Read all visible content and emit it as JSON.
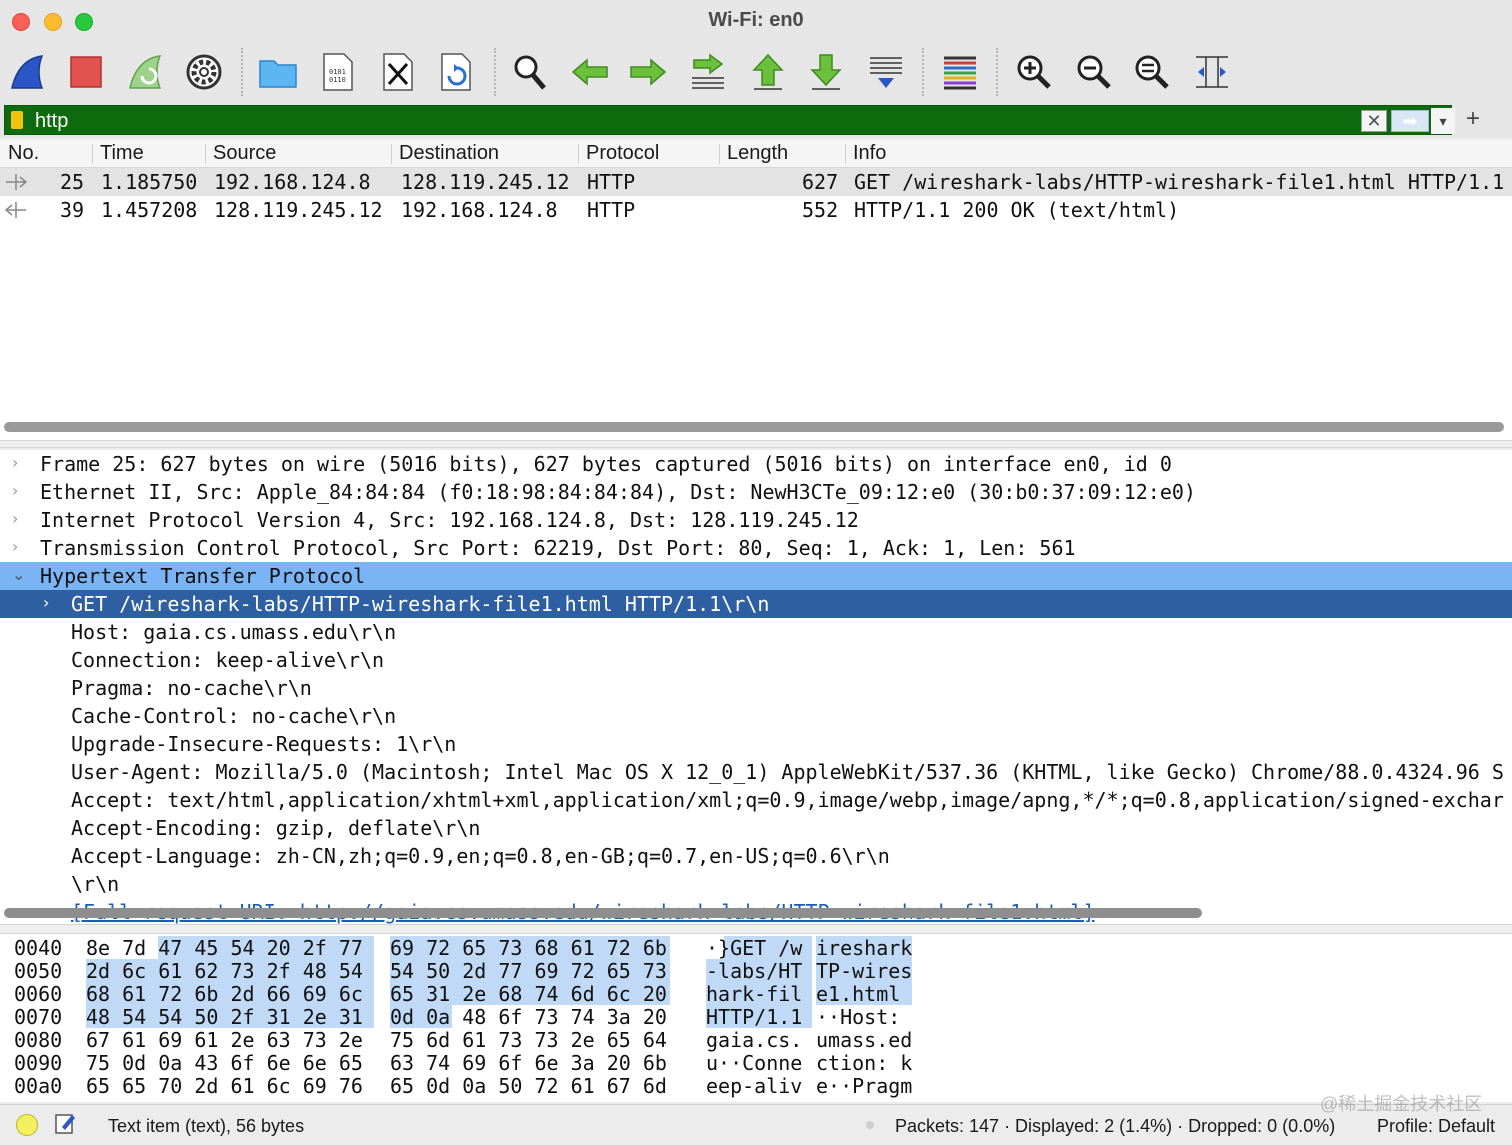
{
  "window": {
    "title": "Wi-Fi: en0"
  },
  "toolbar": {
    "buttons": [
      "shark-fin-start-icon",
      "stop-square-icon",
      "restart-fin-icon",
      "capture-options-gear-icon",
      "open-folder-icon",
      "save-file-icon",
      "close-file-icon",
      "reload-file-icon",
      "find-magnifier-icon",
      "go-back-arrow-icon",
      "go-forward-arrow-icon",
      "go-to-packet-icon",
      "first-packet-icon",
      "last-packet-icon",
      "autoscroll-icon",
      "colorize-icon",
      "zoom-in-icon",
      "zoom-out-icon",
      "normal-size-icon",
      "resize-columns-icon"
    ]
  },
  "filter": {
    "value": "http",
    "clear_glyph": "✕",
    "apply_glyph": "➡",
    "dropdown_glyph": "▾",
    "add_glyph": "+"
  },
  "packet_list": {
    "columns": [
      "No.",
      "Time",
      "Source",
      "Destination",
      "Protocol",
      "Length",
      "Info"
    ],
    "rows": [
      {
        "no": "25",
        "time": "1.185750",
        "source": "192.168.124.8",
        "destination": "128.119.245.12",
        "protocol": "HTTP",
        "length": "627",
        "info": "GET /wireshark-labs/HTTP-wireshark-file1.html HTTP/1.1"
      },
      {
        "no": "39",
        "time": "1.457208",
        "source": "128.119.245.12",
        "destination": "192.168.124.8",
        "protocol": "HTTP",
        "length": "552",
        "info": "HTTP/1.1 200 OK  (text/html)"
      }
    ]
  },
  "details": {
    "tree": [
      {
        "arrow": "›",
        "text": "Frame 25: 627 bytes on wire (5016 bits), 627 bytes captured (5016 bits) on interface en0, id 0"
      },
      {
        "arrow": "›",
        "text": "Ethernet II, Src: Apple_84:84:84 (f0:18:98:84:84:84), Dst: NewH3CTe_09:12:e0 (30:b0:37:09:12:e0)"
      },
      {
        "arrow": "›",
        "text": "Internet Protocol Version 4, Src: 192.168.124.8, Dst: 128.119.245.12"
      },
      {
        "arrow": "›",
        "text": "Transmission Control Protocol, Src Port: 62219, Dst Port: 80, Seq: 1, Ack: 1, Len: 561"
      },
      {
        "arrow": "⌄",
        "text": "Hypertext Transfer Protocol"
      },
      {
        "arrow": "›",
        "text": "GET /wireshark-labs/HTTP-wireshark-file1.html HTTP/1.1\\r\\n"
      },
      {
        "text": "Host: gaia.cs.umass.edu\\r\\n"
      },
      {
        "text": "Connection: keep-alive\\r\\n"
      },
      {
        "text": "Pragma: no-cache\\r\\n"
      },
      {
        "text": "Cache-Control: no-cache\\r\\n"
      },
      {
        "text": "Upgrade-Insecure-Requests: 1\\r\\n"
      },
      {
        "text": "User-Agent: Mozilla/5.0 (Macintosh; Intel Mac OS X 12_0_1) AppleWebKit/537.36 (KHTML, like Gecko) Chrome/88.0.4324.96 S"
      },
      {
        "text": "Accept: text/html,application/xhtml+xml,application/xml;q=0.9,image/webp,image/apng,*/*;q=0.8,application/signed-exchar"
      },
      {
        "text": "Accept-Encoding: gzip, deflate\\r\\n"
      },
      {
        "text": "Accept-Language: zh-CN,zh;q=0.9,en;q=0.8,en-GB;q=0.7,en-US;q=0.6\\r\\n"
      },
      {
        "text": "\\r\\n"
      },
      {
        "text": "[Full request URI: http://gaia.cs.umass.edu/wireshark-labs/HTTP-wireshark-file1.html]"
      }
    ]
  },
  "bytes": {
    "rows": [
      {
        "offset": "0040",
        "hex_left": "8e 7d 47 45 54 20 2f 77",
        "hex_right": "69 72 65 73 68 61 72 6b",
        "ascii_left": "·}GET /w",
        "ascii_right": "ireshark"
      },
      {
        "offset": "0050",
        "hex_left": "2d 6c 61 62 73 2f 48 54",
        "hex_right": "54 50 2d 77 69 72 65 73",
        "ascii_left": "-labs/HT",
        "ascii_right": "TP-wires"
      },
      {
        "offset": "0060",
        "hex_left": "68 61 72 6b 2d 66 69 6c",
        "hex_right": "65 31 2e 68 74 6d 6c 20",
        "ascii_left": "hark-fil",
        "ascii_right": "e1.html "
      },
      {
        "offset": "0070",
        "hex_left": "48 54 54 50 2f 31 2e 31",
        "hex_right": "0d 0a 48 6f 73 74 3a 20",
        "ascii_left": "HTTP/1.1",
        "ascii_right": "··Host: "
      },
      {
        "offset": "0080",
        "hex_left": "67 61 69 61 2e 63 73 2e",
        "hex_right": "75 6d 61 73 73 2e 65 64",
        "ascii_left": "gaia.cs.",
        "ascii_right": "umass.ed"
      },
      {
        "offset": "0090",
        "hex_left": "75 0d 0a 43 6f 6e 6e 65",
        "hex_right": "63 74 69 6f 6e 3a 20 6b",
        "ascii_left": "u··Conne",
        "ascii_right": "ction: k"
      },
      {
        "offset": "00a0",
        "hex_left": "65 65 70 2d 61 6c 69 76",
        "hex_right": "65 0d 0a 50 72 61 67 6d",
        "ascii_left": "eep-aliv",
        "ascii_right": "e··Pragm"
      }
    ]
  },
  "status": {
    "item_text": "Text item (text), 56 bytes",
    "packets": "Packets: 147 · Displayed: 2 (1.4%) · Dropped: 0 (0.0%)",
    "profile": "Profile: Default",
    "watermark": "@稀土掘金技术社区"
  },
  "colors": {
    "filter_valid": "#0d6b0d",
    "selected_row": "#2f5fa3",
    "highlight_row": "#7ab4f5",
    "byte_highlight": "#bfd9f7"
  }
}
